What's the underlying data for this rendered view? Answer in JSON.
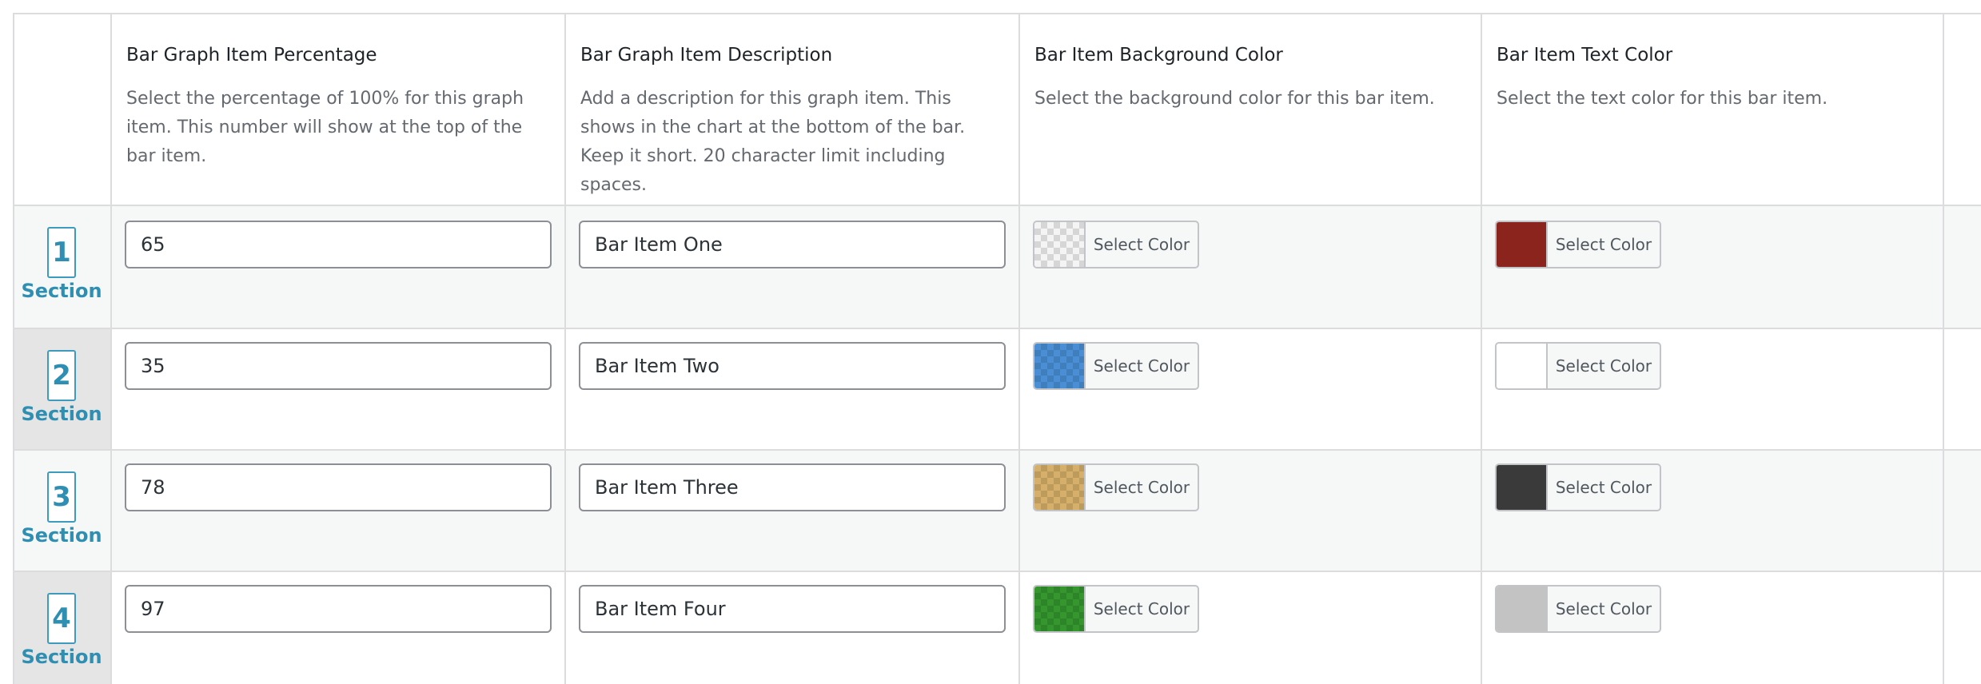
{
  "columns": [
    {
      "title": "Bar Graph Item Percentage",
      "desc_lines": [
        "Select the percentage of 100% for this graph",
        "item. This number will show at the top of the",
        "bar item."
      ]
    },
    {
      "title": "Bar Graph Item Description",
      "desc_lines": [
        "Add a description for this graph item. This",
        "shows in the chart at the bottom of the bar.",
        "Keep it short. 20 character limit including",
        "spaces."
      ]
    },
    {
      "title": "Bar Item Background Color",
      "desc_lines": [
        "Select the background color for this bar item."
      ]
    },
    {
      "title": "Bar Item Text Color",
      "desc_lines": [
        "Select the text color for this bar item."
      ]
    }
  ],
  "select_color_label": "Select Color",
  "rows": [
    {
      "number": "1",
      "section_label": "Section",
      "percentage": "65",
      "description": "Bar Item One",
      "bg_color": "transparent",
      "text_color": "#8b241d"
    },
    {
      "number": "2",
      "section_label": "Section",
      "percentage": "35",
      "description": "Bar Item Two",
      "bg_color": "#4a8fd6",
      "text_color": "#ffffff"
    },
    {
      "number": "3",
      "section_label": "Section",
      "percentage": "78",
      "description": "Bar Item Three",
      "bg_color": "#d6b06a",
      "text_color": "#3a3a3a"
    },
    {
      "number": "4",
      "section_label": "Section",
      "percentage": "97",
      "description": "Bar Item Four",
      "bg_color": "#34962d",
      "text_color": "#c3c3c3"
    }
  ],
  "colors": {
    "section_accent": "#2f8fb3",
    "row_alt_bg": "#f6f7f7",
    "section_alt_bg": "#e5e5e5"
  }
}
